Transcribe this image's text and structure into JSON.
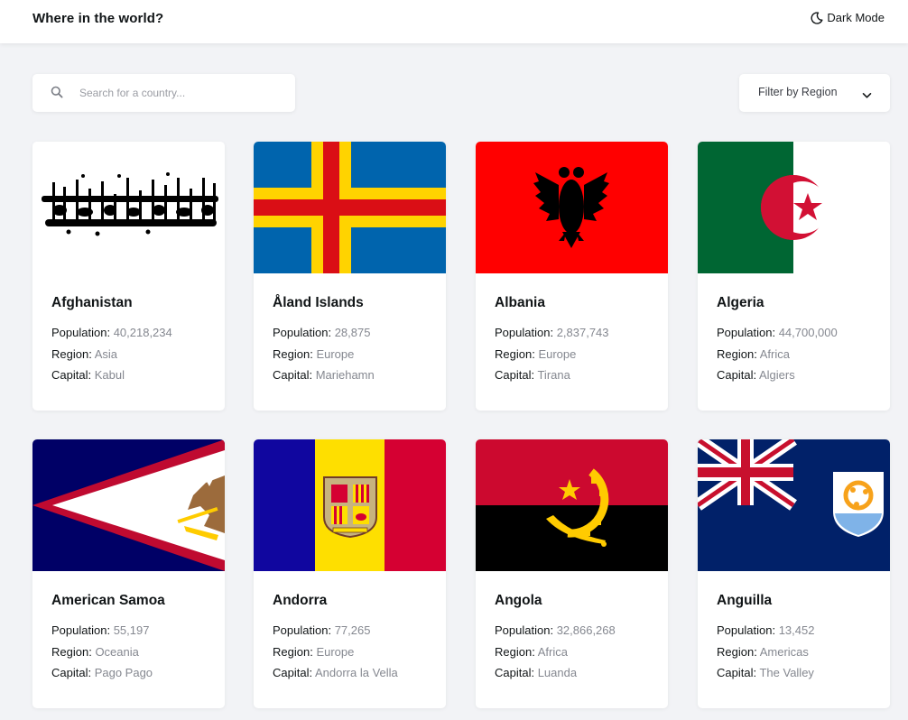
{
  "header": {
    "title": "Where in the world?",
    "dark_mode_label": "Dark Mode"
  },
  "search": {
    "placeholder": "Search for a country...",
    "value": ""
  },
  "filter": {
    "label": "Filter by Region"
  },
  "labels": {
    "population": "Population:",
    "region": "Region:",
    "capital": "Capital:"
  },
  "colors": {
    "background": "#f2f3f6",
    "card": "#ffffff",
    "text": "#111517",
    "muted": "#858890"
  },
  "countries": [
    {
      "name": "Afghanistan",
      "population": "40,218,234",
      "region": "Asia",
      "capital": "Kabul",
      "flag": "flag-afghanistan"
    },
    {
      "name": "Åland Islands",
      "population": "28,875",
      "region": "Europe",
      "capital": "Mariehamn",
      "flag": "flag-aland"
    },
    {
      "name": "Albania",
      "population": "2,837,743",
      "region": "Europe",
      "capital": "Tirana",
      "flag": "flag-albania"
    },
    {
      "name": "Algeria",
      "population": "44,700,000",
      "region": "Africa",
      "capital": "Algiers",
      "flag": "flag-algeria"
    },
    {
      "name": "American Samoa",
      "population": "55,197",
      "region": "Oceania",
      "capital": "Pago Pago",
      "flag": "flag-american-samoa"
    },
    {
      "name": "Andorra",
      "population": "77,265",
      "region": "Europe",
      "capital": "Andorra la Vella",
      "flag": "flag-andorra"
    },
    {
      "name": "Angola",
      "population": "32,866,268",
      "region": "Africa",
      "capital": "Luanda",
      "flag": "flag-angola"
    },
    {
      "name": "Anguilla",
      "population": "13,452",
      "region": "Americas",
      "capital": "The Valley",
      "flag": "flag-anguilla"
    }
  ]
}
